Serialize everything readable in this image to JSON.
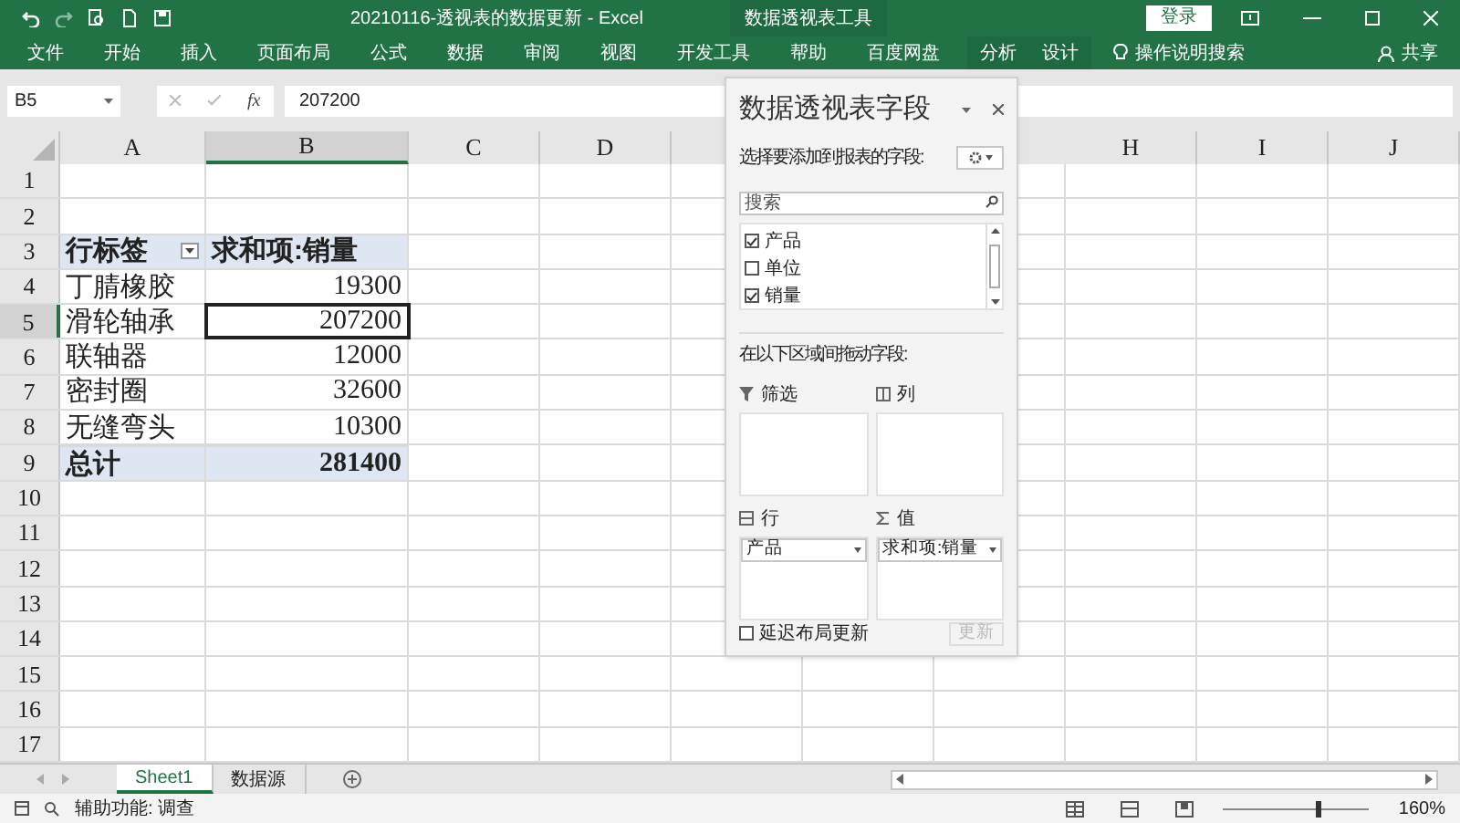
{
  "title_bar": {
    "title": "20210116-透视表的数据更新  -  Excel",
    "context_group": "数据透视表工具",
    "login": "登录"
  },
  "ribbon_tabs": [
    {
      "label": "文件",
      "kind": "normal"
    },
    {
      "label": "开始",
      "kind": "normal"
    },
    {
      "label": "插入",
      "kind": "normal"
    },
    {
      "label": "页面布局",
      "kind": "normal"
    },
    {
      "label": "公式",
      "kind": "normal"
    },
    {
      "label": "数据",
      "kind": "normal"
    },
    {
      "label": "审阅",
      "kind": "normal"
    },
    {
      "label": "视图",
      "kind": "normal"
    },
    {
      "label": "开发工具",
      "kind": "normal"
    },
    {
      "label": "帮助",
      "kind": "normal"
    },
    {
      "label": "百度网盘",
      "kind": "normal"
    },
    {
      "label": "分析",
      "kind": "context"
    },
    {
      "label": "设计",
      "kind": "context"
    }
  ],
  "tell_me": "操作说明搜索",
  "share": "共享",
  "formula_bar": {
    "name_box": "B5",
    "function_button": "fx",
    "value": "207200"
  },
  "columns": [
    {
      "label": "A",
      "selected": false
    },
    {
      "label": "B",
      "selected": true
    },
    {
      "label": "C",
      "selected": false
    },
    {
      "label": "D",
      "selected": false
    },
    {
      "label": "H",
      "selected": false
    },
    {
      "label": "I",
      "selected": false
    },
    {
      "label": "J",
      "selected": false
    }
  ],
  "rows": [
    {
      "label": "1",
      "selected": false,
      "kind": "normal"
    },
    {
      "label": "2",
      "selected": false,
      "kind": "normal"
    },
    {
      "label": "3",
      "selected": false,
      "kind": "header",
      "cells": [
        {
          "text": "行标签",
          "selected": false
        },
        {
          "text": "求和项:销量",
          "selected": false
        }
      ]
    },
    {
      "label": "4",
      "selected": false,
      "kind": "normal",
      "cells": [
        {
          "text": "丁腈橡胶",
          "selected": false
        },
        {
          "text": "19300",
          "selected": false
        }
      ]
    },
    {
      "label": "5",
      "selected": true,
      "kind": "normal",
      "cells": [
        {
          "text": "滑轮轴承",
          "selected": false
        },
        {
          "text": "207200",
          "selected": true
        }
      ]
    },
    {
      "label": "6",
      "selected": false,
      "kind": "normal",
      "cells": [
        {
          "text": "联轴器",
          "selected": false
        },
        {
          "text": "12000",
          "selected": false
        }
      ]
    },
    {
      "label": "7",
      "selected": false,
      "kind": "normal",
      "cells": [
        {
          "text": "密封圈",
          "selected": false
        },
        {
          "text": "32600",
          "selected": false
        }
      ]
    },
    {
      "label": "8",
      "selected": false,
      "kind": "normal",
      "cells": [
        {
          "text": "无缝弯头",
          "selected": false
        },
        {
          "text": "10300",
          "selected": false
        }
      ]
    },
    {
      "label": "9",
      "selected": false,
      "kind": "total",
      "cells": [
        {
          "text": "总计",
          "selected": false
        },
        {
          "text": "281400",
          "selected": false
        }
      ]
    },
    {
      "label": "10",
      "selected": false,
      "kind": "normal"
    },
    {
      "label": "11",
      "selected": false,
      "kind": "normal"
    },
    {
      "label": "12",
      "selected": false,
      "kind": "normal"
    },
    {
      "label": "13",
      "selected": false,
      "kind": "normal"
    },
    {
      "label": "14",
      "selected": false,
      "kind": "normal"
    },
    {
      "label": "15",
      "selected": false,
      "kind": "normal"
    },
    {
      "label": "16",
      "selected": false,
      "kind": "normal"
    },
    {
      "label": "17",
      "selected": false,
      "kind": "normal"
    }
  ],
  "pivot_pane": {
    "title": "数据透视表字段",
    "subtitle": "选择要添加到报表的字段:",
    "search_placeholder": "搜索",
    "fields": [
      {
        "label": "产品",
        "checked": true
      },
      {
        "label": "单位",
        "checked": false
      },
      {
        "label": "销量",
        "checked": true
      }
    ],
    "drag_hint": "在以下区域间拖动字段:",
    "areas": [
      {
        "kind": "filter",
        "label": "筛选"
      },
      {
        "kind": "columns",
        "label": "列"
      },
      {
        "kind": "rows",
        "label": "行",
        "items": [
          "产品"
        ]
      },
      {
        "kind": "values",
        "label": "值",
        "items": [
          "求和项:销量"
        ]
      }
    ],
    "defer": {
      "label": "延迟布局更新",
      "checked": false
    },
    "update": {
      "label": "更新",
      "disabled": true
    }
  },
  "sheet_tabs": [
    {
      "label": "Sheet1",
      "selected": true
    },
    {
      "label": "数据源",
      "selected": false
    }
  ],
  "status_bar": {
    "accessibility": "辅助功能: 调查",
    "zoom": "160%",
    "zoom_slider": {
      "level": 0.66
    }
  }
}
